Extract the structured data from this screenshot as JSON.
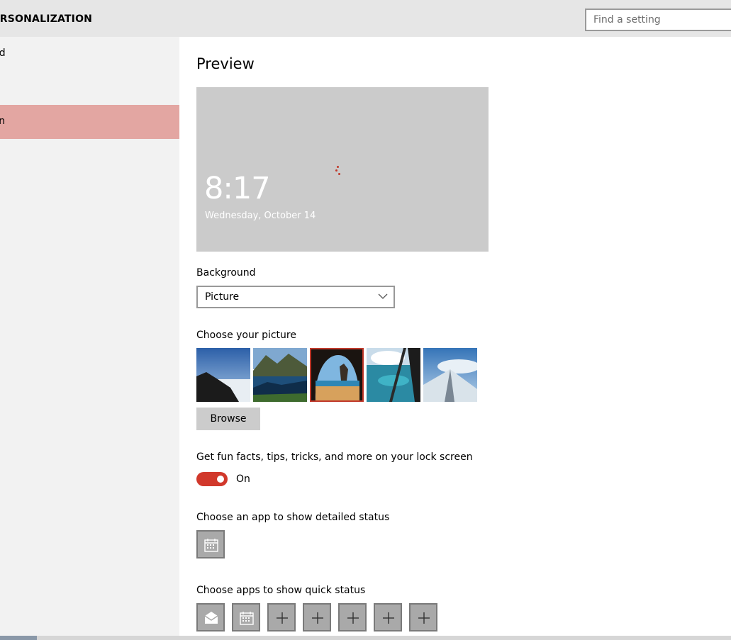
{
  "header": {
    "title": "ERSONALIZATION",
    "search_placeholder": "Find a setting"
  },
  "sidebar": {
    "items": [
      {
        "label": "und",
        "selected": false
      },
      {
        "label": "een",
        "selected": true
      }
    ]
  },
  "main": {
    "preview_heading": "Preview",
    "preview": {
      "time": "8:17",
      "date": "Wednesday, October 14"
    },
    "background_label": "Background",
    "background_value": "Picture",
    "choose_picture_label": "Choose your picture",
    "browse_label": "Browse",
    "fun_facts_label": "Get fun facts, tips, tricks, and more on your lock screen",
    "toggle_state": "On",
    "detailed_status_label": "Choose an app to show detailed status",
    "quick_status_label": "Choose apps to show quick status"
  },
  "icons": {
    "detailed_app": "calendar-icon",
    "quick_apps": [
      "mail-icon",
      "calendar-icon",
      "plus-icon",
      "plus-icon",
      "plus-icon",
      "plus-icon",
      "plus-icon"
    ]
  },
  "colors": {
    "accent": "#d1382b",
    "selected_sidebar": "#e3a6a2",
    "header_bg": "#e6e6e6",
    "sidebar_bg": "#f2f2f2"
  }
}
